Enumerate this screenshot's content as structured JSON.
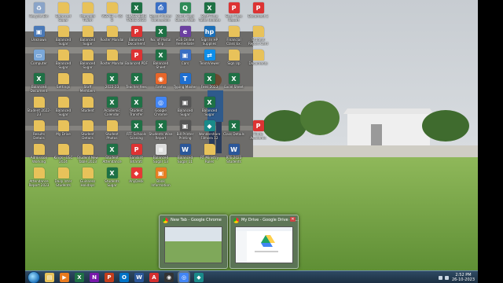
{
  "desktop": {
    "icons": [
      {
        "label": "Recycle Bin",
        "icon": "recycle-bin-icon",
        "color": "#8aa4c8",
        "glyph": "♻"
      },
      {
        "label": "Balanced Sugar",
        "icon": "folder-icon",
        "color": "#e8c25a",
        "glyph": ""
      },
      {
        "label": "Mangalal Tiwari",
        "icon": "folder-icon",
        "color": "#e8c25a",
        "glyph": ""
      },
      {
        "label": "VSS 82 + 05 8",
        "icon": "folder-icon",
        "color": "#e8c25a",
        "glyph": ""
      },
      {
        "label": "CLASS 8841 TABLE 2021",
        "icon": "excel-icon",
        "color": "#1e7145",
        "glyph": "X"
      },
      {
        "label": "Epson Printer Connection",
        "icon": "printer-icon",
        "color": "#3a6fc4",
        "glyph": "⎙"
      },
      {
        "label": "Quick Heal Secure Web",
        "icon": "quickheal-icon",
        "color": "#2e8b57",
        "glyph": "Q"
      },
      {
        "label": "Staff Time Table Update",
        "icon": "excel-icon",
        "color": "#1e7145",
        "glyph": "X"
      },
      {
        "label": "Scan Fees Report",
        "icon": "pdf-icon",
        "color": "#d33",
        "glyph": "P"
      },
      {
        "label": "Document 1",
        "icon": "pdf-icon",
        "color": "#d33",
        "glyph": "P"
      },
      {
        "label": "Unknown",
        "icon": "app-icon",
        "color": "#4a79b8",
        "glyph": "▣"
      },
      {
        "label": "Balanced Sugar",
        "icon": "folder-icon",
        "color": "#e8c25a",
        "glyph": ""
      },
      {
        "label": "Balanced Sugar",
        "icon": "folder-icon",
        "color": "#e8c25a",
        "glyph": ""
      },
      {
        "label": "Roster Mandal",
        "icon": "folder-icon",
        "color": "#e8c25a",
        "glyph": ""
      },
      {
        "label": "Balanced Document",
        "icon": "pdf-icon",
        "color": "#d33",
        "glyph": "P"
      },
      {
        "label": "No. of Postal Slip",
        "icon": "excel-icon",
        "color": "#1e7145",
        "glyph": "X"
      },
      {
        "label": "eGS Online Remediate",
        "icon": "app-icon",
        "color": "#6b3fa0",
        "glyph": "e"
      },
      {
        "label": "Sign In HP Supplies",
        "icon": "app-icon",
        "color": "#1b6fb8",
        "glyph": "hp"
      },
      {
        "label": "Financial Class Ex.",
        "icon": "folder-icon",
        "color": "#e8c25a",
        "glyph": ""
      },
      {
        "label": "Student Report Card",
        "icon": "folder-icon",
        "color": "#e8c25a",
        "glyph": ""
      },
      {
        "label": "Computer",
        "icon": "computer-icon",
        "color": "#7aa7d8",
        "glyph": "▭"
      },
      {
        "label": "Balanced Sugar",
        "icon": "folder-icon",
        "color": "#e8c25a",
        "glyph": ""
      },
      {
        "label": "Balanced Sugar",
        "icon": "folder-icon",
        "color": "#e8c25a",
        "glyph": ""
      },
      {
        "label": "Roster Mandal",
        "icon": "folder-icon",
        "color": "#e8c25a",
        "glyph": ""
      },
      {
        "label": "Balanced PDF",
        "icon": "pdf-icon",
        "color": "#d33",
        "glyph": "P"
      },
      {
        "label": "Balanced Sheet",
        "icon": "excel-icon",
        "color": "#1e7145",
        "glyph": "X"
      },
      {
        "label": "Cars",
        "icon": "app-icon",
        "color": "#3a6fc4",
        "glyph": "▣"
      },
      {
        "label": "TeamViewer",
        "icon": "teamviewer-icon",
        "color": "#0e8ee9",
        "glyph": "⇄"
      },
      {
        "label": "Sign Up",
        "icon": "folder-icon",
        "color": "#e8c25a",
        "glyph": ""
      },
      {
        "label": "Documents",
        "icon": "folder-icon",
        "color": "#e8c25a",
        "glyph": ""
      },
      {
        "label": "Balanced Document",
        "icon": "excel-icon",
        "color": "#1e7145",
        "glyph": "X"
      },
      {
        "label": "Settings",
        "icon": "folder-icon",
        "color": "#e8c25a",
        "glyph": ""
      },
      {
        "label": "Staff Members",
        "icon": "folder-icon",
        "color": "#e8c25a",
        "glyph": ""
      },
      {
        "label": "2022-23",
        "icon": "excel-icon",
        "color": "#1e7145",
        "glyph": "X"
      },
      {
        "label": "Teacher fees",
        "icon": "excel-icon",
        "color": "#1e7145",
        "glyph": "X"
      },
      {
        "label": "Firefox",
        "icon": "firefox-icon",
        "color": "#e8662a",
        "glyph": "◉"
      },
      {
        "label": "Typing Master",
        "icon": "app-icon",
        "color": "#1e6fd0",
        "glyph": "T"
      },
      {
        "label": "Fees 2023",
        "icon": "excel-icon",
        "color": "#1e7145",
        "glyph": "X"
      },
      {
        "label": "Excel Sheet",
        "icon": "excel-icon",
        "color": "#1e7145",
        "glyph": "X"
      },
      {
        "label": "",
        "icon": "blank-icon",
        "color": "transparent",
        "glyph": ""
      },
      {
        "label": "Student 2022-23",
        "icon": "folder-icon",
        "color": "#e8c25a",
        "glyph": ""
      },
      {
        "label": "Balanced Sugar",
        "icon": "folder-icon",
        "color": "#e8c25a",
        "glyph": ""
      },
      {
        "label": "Student",
        "icon": "folder-icon",
        "color": "#e8c25a",
        "glyph": ""
      },
      {
        "label": "Academic Calendar",
        "icon": "excel-icon",
        "color": "#1e7145",
        "glyph": "X"
      },
      {
        "label": "Student Transfer",
        "icon": "excel-icon",
        "color": "#1e7145",
        "glyph": "X"
      },
      {
        "label": "Google Chrome",
        "icon": "chrome-icon",
        "color": "#4285f4",
        "glyph": "◎"
      },
      {
        "label": "Balanced Sugar",
        "icon": "app-icon",
        "color": "#555",
        "glyph": "▣"
      },
      {
        "label": "Balanced Sugar",
        "icon": "excel-icon",
        "color": "#1e7145",
        "glyph": "X"
      },
      {
        "label": "",
        "icon": "blank-icon",
        "color": "transparent",
        "glyph": ""
      },
      {
        "label": "",
        "icon": "blank-icon",
        "color": "transparent",
        "glyph": ""
      },
      {
        "label": "Results Details",
        "icon": "folder-icon",
        "color": "#e8c25a",
        "glyph": ""
      },
      {
        "label": "My Drive",
        "icon": "folder-icon",
        "color": "#e8c25a",
        "glyph": ""
      },
      {
        "label": "Student Details",
        "icon": "folder-icon",
        "color": "#e8c25a",
        "glyph": ""
      },
      {
        "label": "Student Photos",
        "icon": "folder-icon",
        "color": "#e8c25a",
        "glyph": ""
      },
      {
        "label": "RTF Schools Scaning",
        "icon": "excel-icon",
        "color": "#1e7145",
        "glyph": "X"
      },
      {
        "label": "Students Wise Report",
        "icon": "excel-icon",
        "color": "#1e7145",
        "glyph": "X"
      },
      {
        "label": "Bill Printer Printing",
        "icon": "app-icon",
        "color": "#555",
        "glyph": "▣"
      },
      {
        "label": "Wondershare Filmora 12",
        "icon": "filmora-icon",
        "color": "#1a8a8a",
        "glyph": "◆"
      },
      {
        "label": "Class Details",
        "icon": "excel-icon",
        "color": "#1e7145",
        "glyph": "X"
      },
      {
        "label": "Hindu Academic",
        "icon": "pdf-icon",
        "color": "#d33",
        "glyph": "P"
      },
      {
        "label": "Admission Working",
        "icon": "folder-icon",
        "color": "#e8c25a",
        "glyph": ""
      },
      {
        "label": "Kings - BSC 2024",
        "icon": "folder-icon",
        "color": "#e8c25a",
        "glyph": ""
      },
      {
        "label": "Student New Table 2023",
        "icon": "folder-icon",
        "color": "#e8c25a",
        "glyph": ""
      },
      {
        "label": "Student Attendance",
        "icon": "excel-icon",
        "color": "#1e7145",
        "glyph": "X"
      },
      {
        "label": "Sanskrit Bharati",
        "icon": "pdf-icon",
        "color": "#d33",
        "glyph": "P"
      },
      {
        "label": "Balanced Sugar 13",
        "icon": "doc-icon",
        "color": "#ddd",
        "glyph": "≡"
      },
      {
        "label": "Balanced Sugar 11",
        "icon": "word-icon",
        "color": "#2b579a",
        "glyph": "W"
      },
      {
        "label": "RT Ministry Rules",
        "icon": "folder-icon",
        "color": "#e8c25a",
        "glyph": ""
      },
      {
        "label": "RTE 2023 Students",
        "icon": "word-icon",
        "color": "#2b579a",
        "glyph": "W"
      },
      {
        "label": "",
        "icon": "blank-icon",
        "color": "transparent",
        "glyph": ""
      },
      {
        "label": "Attendance Report 2023",
        "icon": "folder-icon",
        "color": "#e8c25a",
        "glyph": ""
      },
      {
        "label": "Daily Inter Students",
        "icon": "folder-icon",
        "color": "#e8c25a",
        "glyph": ""
      },
      {
        "label": "Guinness Holidays",
        "icon": "folder-icon",
        "color": "#e8c25a",
        "glyph": ""
      },
      {
        "label": "Students Sugar",
        "icon": "excel-icon",
        "color": "#1e7145",
        "glyph": "X"
      },
      {
        "label": "AnyDesk",
        "icon": "anydesk-icon",
        "color": "#e53935",
        "glyph": "◆"
      },
      {
        "label": "Bank Information",
        "icon": "app-icon",
        "color": "#e67e22",
        "glyph": "▣"
      },
      {
        "label": "",
        "icon": "blank-icon",
        "color": "transparent",
        "glyph": ""
      },
      {
        "label": "",
        "icon": "blank-icon",
        "color": "transparent",
        "glyph": ""
      },
      {
        "label": "",
        "icon": "blank-icon",
        "color": "transparent",
        "glyph": ""
      },
      {
        "label": "",
        "icon": "blank-icon",
        "color": "transparent",
        "glyph": ""
      }
    ]
  },
  "previews": [
    {
      "title": "New Tab - Google Chrome",
      "kind": "chrome"
    },
    {
      "title": "My Drive - Google Drive - G...",
      "kind": "drive"
    }
  ],
  "taskbar": {
    "items": [
      {
        "icon": "explorer-icon",
        "color": "#e8c25a",
        "glyph": "▤"
      },
      {
        "icon": "media-player-icon",
        "color": "#e87a1e",
        "glyph": "▶"
      },
      {
        "icon": "excel-icon",
        "color": "#1e7145",
        "glyph": "X"
      },
      {
        "icon": "onenote-icon",
        "color": "#7719aa",
        "glyph": "N"
      },
      {
        "icon": "powerpoint-icon",
        "color": "#c43e1c",
        "glyph": "P"
      },
      {
        "icon": "outlook-icon",
        "color": "#0072c6",
        "glyph": "O"
      },
      {
        "icon": "word-icon",
        "color": "#2b579a",
        "glyph": "W"
      },
      {
        "icon": "acrobat-icon",
        "color": "#d32f2f",
        "glyph": "A"
      },
      {
        "icon": "app-icon",
        "color": "#333",
        "glyph": "◉"
      },
      {
        "icon": "chrome-icon",
        "color": "#4285f4",
        "glyph": "◎",
        "active": true
      },
      {
        "icon": "filmora-icon",
        "color": "#1a8a8a",
        "glyph": "◆"
      }
    ],
    "time": "2:52 PM",
    "date": "26-10-2023"
  }
}
